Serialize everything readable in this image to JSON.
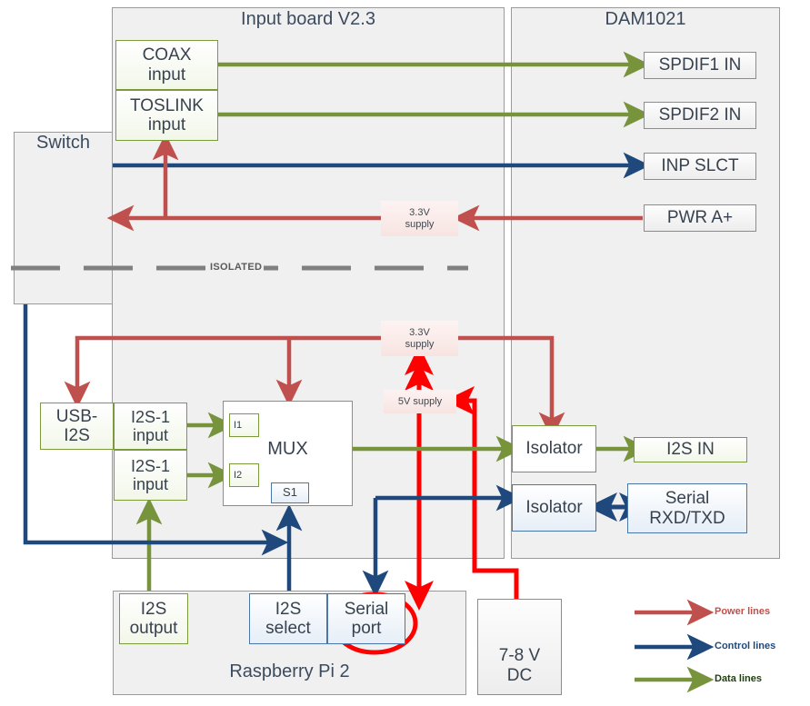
{
  "diagram": {
    "title_hidden": "",
    "panels": [
      {
        "id": "input_board",
        "label": "Input board V2.3"
      },
      {
        "id": "dam1021",
        "label": "DAM1021"
      },
      {
        "id": "switch",
        "label": "Switch"
      },
      {
        "id": "rpi",
        "label": "Raspberry Pi 2"
      }
    ],
    "isolation_label": "ISOLATED",
    "nodes": {
      "coax_input": "COAX\ninput",
      "coax_line1": "COAX",
      "coax_line2": "input",
      "toslink_line1": "TOSLINK",
      "toslink_line2": "input",
      "spdif1_in": "SPDIF1 IN",
      "spdif2_in": "SPDIF2 IN",
      "inp_slct": "INP SLCT",
      "pwr_a_plus": "PWR A+",
      "supply_33_top_l1": "3.3V",
      "supply_33_top_l2": "supply",
      "supply_33_bot_l1": "3.3V",
      "supply_33_bot_l2": "supply",
      "supply_5v": "5V supply",
      "usb_i2s_l1": "USB-",
      "usb_i2s_l2": "I2S",
      "i2s1_input_a_l1": "I2S-1",
      "i2s1_input_a_l2": "input",
      "i2s1_input_b_l1": "I2S-1",
      "i2s1_input_b_l2": "input",
      "mux": "MUX",
      "mux_i1": "I1",
      "mux_i2": "I2",
      "mux_s1": "S1",
      "isolator_data": "Isolator",
      "isolator_ctrl": "Isolator",
      "i2s_in": "I2S IN",
      "serial_rxd_txd_l1": "Serial",
      "serial_rxd_txd_l2": "RXD/TXD",
      "i2s_output_l1": "I2S",
      "i2s_output_l2": "output",
      "i2s_select_l1": "I2S",
      "i2s_select_l2": "select",
      "serial_port_l1": "Serial",
      "serial_port_l2": "port",
      "psu_l1": "7-8 V",
      "psu_l2": "DC"
    },
    "legend": {
      "items": [
        {
          "label": "Power lines",
          "color": "#c0504d"
        },
        {
          "label": "Control lines",
          "color": "#1f497d"
        },
        {
          "label": "Data lines",
          "color": "#77933c"
        }
      ]
    },
    "colors": {
      "power": "#c0504d",
      "power_bright": "#ff0000",
      "control": "#1f497d",
      "data": "#77933c",
      "annotation": "#ff0000",
      "panel_bg": "#f0f0f0",
      "panel_border": "#9a9a9a",
      "text": "#3c4a5e"
    },
    "annotation": {
      "name": "serial-port-highlight",
      "shape": "ellipse",
      "color": "#ff0000"
    }
  }
}
